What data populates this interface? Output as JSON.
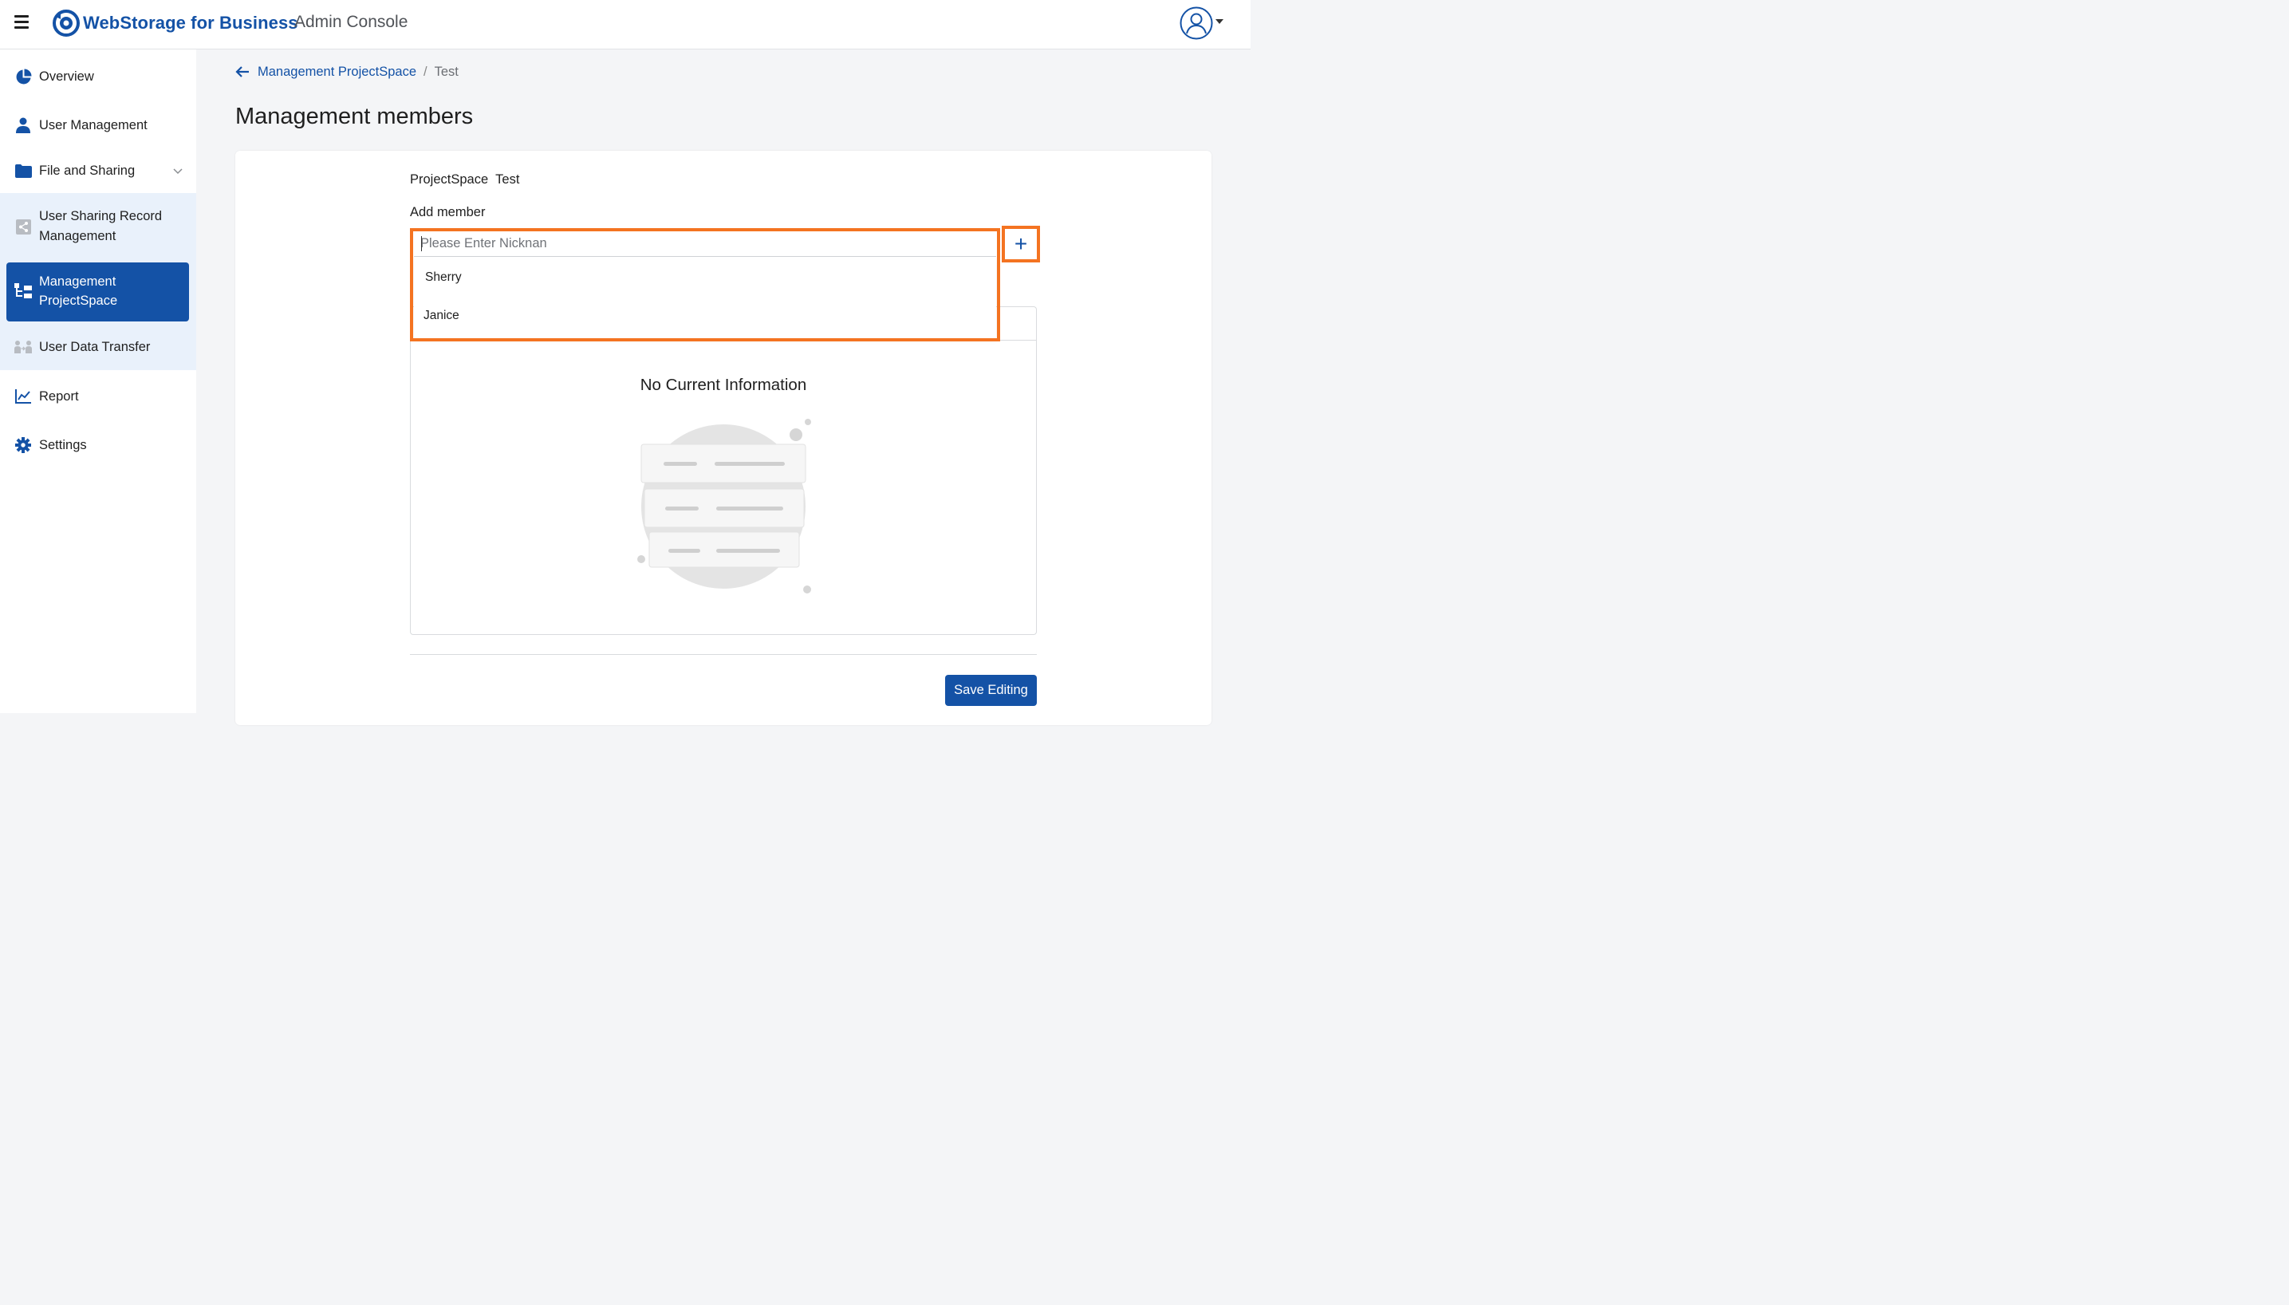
{
  "header": {
    "brand": "WebStorage for Business",
    "subtitle": "Admin Console",
    "brand_color": "#1452a6"
  },
  "sidebar": {
    "items": [
      {
        "label": "Overview",
        "icon": "pie-chart-icon"
      },
      {
        "label": "User Management",
        "icon": "user-icon"
      },
      {
        "label": "File and Sharing",
        "icon": "folder-icon"
      },
      {
        "label": "User Sharing Record Management",
        "icon": "share-icon"
      },
      {
        "label": "Management ProjectSpace",
        "icon": "org-tree-icon",
        "active": true
      },
      {
        "label": "User Data Transfer",
        "icon": "transfer-icon"
      },
      {
        "label": "Report",
        "icon": "line-chart-icon"
      },
      {
        "label": "Settings",
        "icon": "gear-icon"
      }
    ],
    "item3_line1": "User Sharing Record",
    "item3_line2": "Management",
    "item4_line1": "Management",
    "item4_line2": "ProjectSpace"
  },
  "breadcrumb": {
    "parent": "Management ProjectSpace",
    "separator": "/",
    "current": "Test"
  },
  "page": {
    "title": "Management members"
  },
  "form": {
    "projectspace_label": "ProjectSpace",
    "projectspace_value": "Test",
    "add_member_label": "Add member",
    "search_value": "",
    "search_placeholder": "Please Enter Nicknan",
    "add_button": "+",
    "suggestions": [
      "Sherry",
      "Janice"
    ]
  },
  "table": {
    "empty_message": "No Current Information"
  },
  "footer": {
    "save_label": "Save Editing"
  },
  "colors": {
    "highlight": "#f47321",
    "primary": "#1452a6",
    "active_bg": "#1452a6",
    "submenu_bg": "#e9f1fb"
  }
}
